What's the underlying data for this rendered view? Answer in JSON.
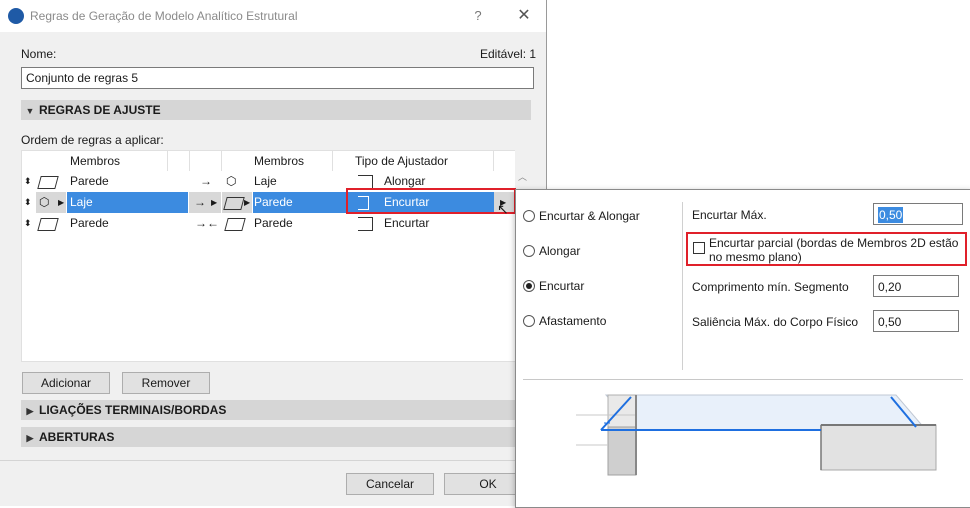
{
  "dialog": {
    "title": "Regras de Geração de Modelo Analítico Estrutural",
    "help_label": "?",
    "close_label": "✕",
    "name_label": "Nome:",
    "editable_label": "Editável: 1",
    "name_value": "Conjunto de regras 5",
    "section_adjust": "REGRAS DE AJUSTE",
    "order_label": "Ordem de regras a aplicar:",
    "headers": {
      "members_a": "Membros",
      "members_b": "Membros",
      "adjuster": "Tipo de Ajustador"
    },
    "rows": [
      {
        "member_a": "Parede",
        "member_b": "Laje",
        "adjuster": "Alongar",
        "arrow": "→"
      },
      {
        "member_a": "Laje",
        "member_b": "Parede",
        "adjuster": "Encurtar",
        "arrow": "→"
      },
      {
        "member_a": "Parede",
        "member_b": "Parede",
        "adjuster": "Encurtar",
        "arrow": "→←"
      }
    ],
    "add_button": "Adicionar",
    "remove_button": "Remover",
    "section_terminals": "LIGAÇÕES TERMINAIS/BORDAS",
    "section_openings": "ABERTURAS",
    "cancel_button": "Cancelar",
    "ok_button": "OK"
  },
  "popover": {
    "options": [
      "Encurtar & Alongar",
      "Alongar",
      "Encurtar",
      "Afastamento"
    ],
    "selected_option": "Encurtar",
    "max_shorten_label": "Encurtar Máx.",
    "max_shorten_value": "0,50",
    "partial_label": "Encurtar parcial (bordas de Membros 2D estão no mesmo plano)",
    "min_segment_label": "Comprimento mín. Segmento",
    "min_segment_value": "0,20",
    "max_overhang_label": "Saliência Máx. do Corpo Físico",
    "max_overhang_value": "0,50"
  },
  "colors": {
    "selection": "#3c8be0",
    "highlight": "#e0202a",
    "accent_line": "#1e6fe0"
  }
}
